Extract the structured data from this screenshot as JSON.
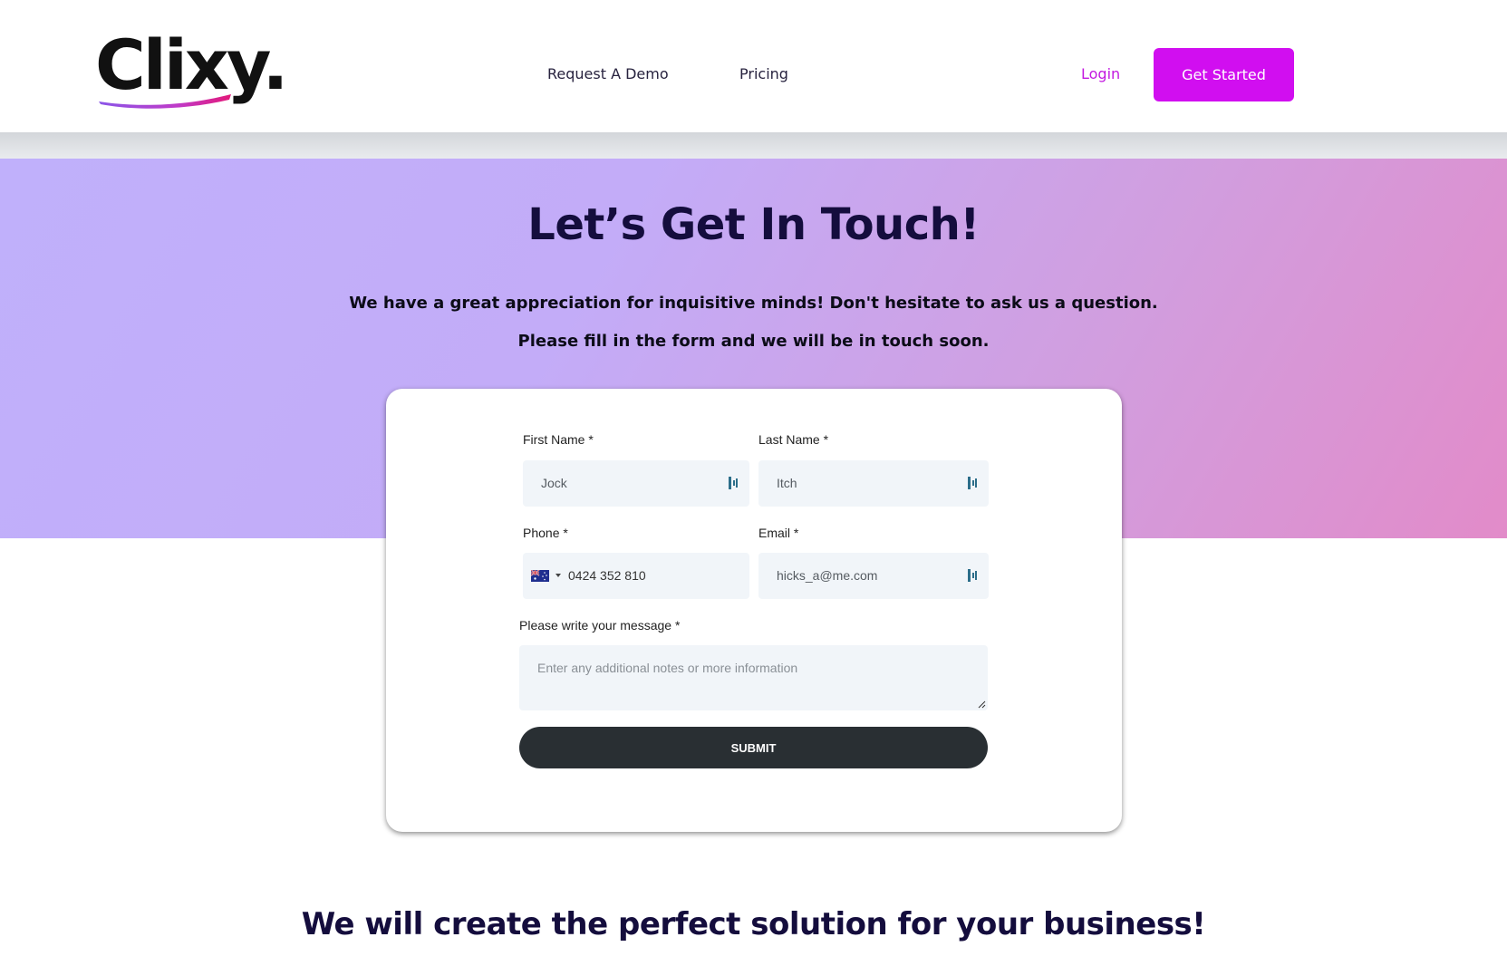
{
  "header": {
    "logo_text": "Clixy.",
    "nav": {
      "request_demo": "Request A Demo",
      "pricing": "Pricing",
      "login": "Login",
      "get_started": "Get Started"
    }
  },
  "hero": {
    "title": "Let’s Get In Touch!",
    "line1": "We have a great appreciation for inquisitive minds! Don't hesitate to ask us a question.",
    "line2": "Please fill in the form and we will be in touch soon."
  },
  "form": {
    "first_name": {
      "label": "First Name *",
      "value": "Jock"
    },
    "last_name": {
      "label": "Last Name *",
      "value": "Itch"
    },
    "phone": {
      "label": "Phone *",
      "value": "0424 352 810",
      "country_flag": "australia-flag-icon"
    },
    "email": {
      "label": "Email *",
      "value": "hicks_a@me.com"
    },
    "message": {
      "label": "Please write your message *",
      "placeholder": "Enter any additional notes or more information"
    },
    "submit_label": "SUBMIT"
  },
  "bottom": {
    "title": "We will create the perfect solution for your business!"
  },
  "colors": {
    "brand_magenta": "#d10ef0",
    "login_color": "#c319e0",
    "title_navy": "#140d3d",
    "submit_dark": "#292f33"
  }
}
